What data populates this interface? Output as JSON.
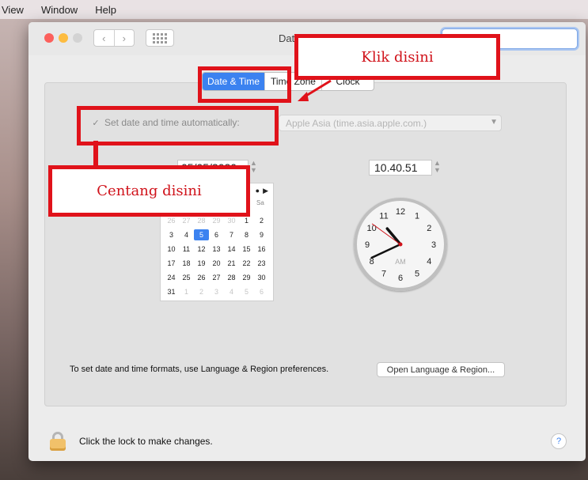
{
  "menubar": {
    "items": [
      "View",
      "Window",
      "Help"
    ]
  },
  "window": {
    "title": "Date",
    "tabs": [
      "Date & Time",
      "Time Zone",
      "Clock"
    ],
    "auto_label": "Set date and time automatically:",
    "server": "Apple Asia (time.asia.apple.com.)",
    "date_value": "05/05/2020",
    "time_value": "10.40.51",
    "calendar": {
      "weekday_sa": "Sa",
      "rows": [
        [
          "26",
          "27",
          "28",
          "29",
          "30",
          "1",
          "2"
        ],
        [
          "3",
          "4",
          "5",
          "6",
          "7",
          "8",
          "9"
        ],
        [
          "10",
          "11",
          "12",
          "13",
          "14",
          "15",
          "16"
        ],
        [
          "17",
          "18",
          "19",
          "20",
          "21",
          "22",
          "23"
        ],
        [
          "24",
          "25",
          "26",
          "27",
          "28",
          "29",
          "30"
        ],
        [
          "31",
          "1",
          "2",
          "3",
          "4",
          "5",
          "6"
        ]
      ],
      "selected": "5"
    },
    "clock": {
      "numbers": [
        "12",
        "1",
        "2",
        "3",
        "4",
        "5",
        "6",
        "7",
        "8",
        "9",
        "10",
        "11"
      ],
      "ampm": "AM",
      "hour": 10,
      "minute": 40,
      "second": 51
    },
    "hint_text": "To set date and time formats, use Language & Region preferences.",
    "open_lang_button": "Open Language & Region...",
    "lock_text": "Click the lock to make changes.",
    "help_label": "?"
  },
  "annotations": {
    "klik": "Klik disini",
    "centang": "Centang disini"
  },
  "colors": {
    "accent": "#3b82f0",
    "annotation": "#e0121a"
  }
}
